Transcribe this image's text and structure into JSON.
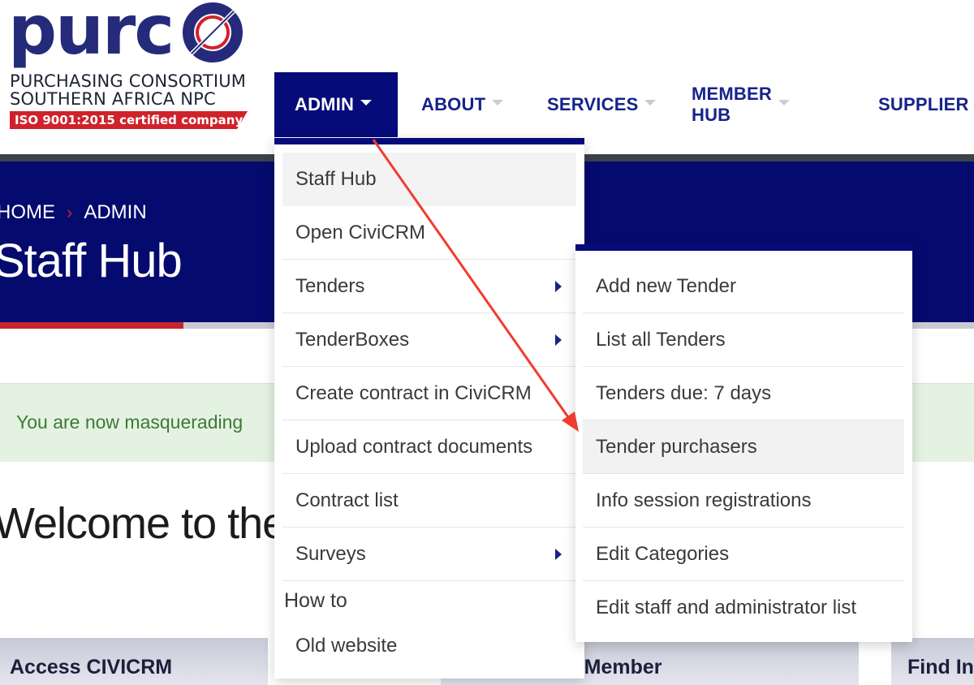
{
  "logo": {
    "word": "purc",
    "line1": "PURCHASING CONSORTIUM",
    "line2": "SOUTHERN AFRICA NPC",
    "badge": "ISO 9001:2015 certified company",
    "colors": {
      "navy": "#262a7a",
      "red": "#d0222b"
    }
  },
  "nav": {
    "items": [
      {
        "label": "ADMIN"
      },
      {
        "label": "ABOUT"
      },
      {
        "label": "SERVICES"
      },
      {
        "label": "MEMBER HUB"
      },
      {
        "label": "SUPPLIER H"
      }
    ]
  },
  "hero": {
    "breadcrumb": {
      "home": "HOME",
      "separator": "›",
      "current": "ADMIN"
    },
    "title": "Staff Hub",
    "accent": "#c8242f",
    "background": "#050a6e"
  },
  "alert": {
    "text": "You are now masquerading"
  },
  "welcome": {
    "text": "Welcome to the"
  },
  "cards": [
    {
      "label": "Access CIVICRM"
    },
    {
      "label": "r/Member"
    },
    {
      "label": "Find In"
    }
  ],
  "admin_menu": {
    "items": [
      {
        "label": "Staff Hub"
      },
      {
        "label": "Open CiviCRM"
      },
      {
        "label": "Tenders"
      },
      {
        "label": "TenderBoxes"
      },
      {
        "label": "Create contract in CiviCRM"
      },
      {
        "label": "Upload contract documents"
      },
      {
        "label": "Contract list"
      },
      {
        "label": "Surveys"
      }
    ],
    "heading": "How to",
    "extra": "Old website"
  },
  "tenders_submenu": {
    "items": [
      {
        "label": "Add new Tender"
      },
      {
        "label": "List all Tenders"
      },
      {
        "label": "Tenders due: 7 days"
      },
      {
        "label": "Tender purchasers"
      },
      {
        "label": "Info session registrations"
      },
      {
        "label": "Edit Categories"
      },
      {
        "label": "Edit staff and administrator list"
      }
    ]
  },
  "annotation_color": "#f03c2e"
}
